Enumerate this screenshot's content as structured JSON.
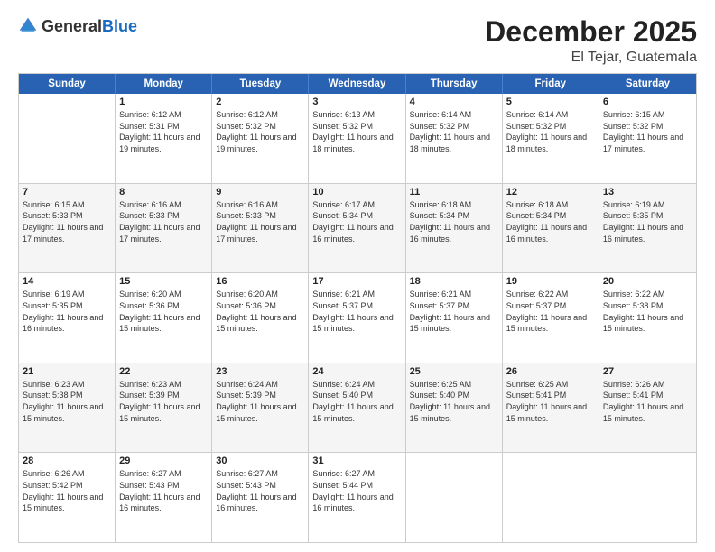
{
  "header": {
    "logo_general": "General",
    "logo_blue": "Blue",
    "month": "December 2025",
    "location": "El Tejar, Guatemala"
  },
  "days_of_week": [
    "Sunday",
    "Monday",
    "Tuesday",
    "Wednesday",
    "Thursday",
    "Friday",
    "Saturday"
  ],
  "weeks": [
    [
      {
        "day": "",
        "sunrise": "",
        "sunset": "",
        "daylight": ""
      },
      {
        "day": "1",
        "sunrise": "6:12 AM",
        "sunset": "5:31 PM",
        "daylight": "11 hours and 19 minutes."
      },
      {
        "day": "2",
        "sunrise": "6:12 AM",
        "sunset": "5:32 PM",
        "daylight": "11 hours and 19 minutes."
      },
      {
        "day": "3",
        "sunrise": "6:13 AM",
        "sunset": "5:32 PM",
        "daylight": "11 hours and 18 minutes."
      },
      {
        "day": "4",
        "sunrise": "6:14 AM",
        "sunset": "5:32 PM",
        "daylight": "11 hours and 18 minutes."
      },
      {
        "day": "5",
        "sunrise": "6:14 AM",
        "sunset": "5:32 PM",
        "daylight": "11 hours and 18 minutes."
      },
      {
        "day": "6",
        "sunrise": "6:15 AM",
        "sunset": "5:32 PM",
        "daylight": "11 hours and 17 minutes."
      }
    ],
    [
      {
        "day": "7",
        "sunrise": "6:15 AM",
        "sunset": "5:33 PM",
        "daylight": "11 hours and 17 minutes."
      },
      {
        "day": "8",
        "sunrise": "6:16 AM",
        "sunset": "5:33 PM",
        "daylight": "11 hours and 17 minutes."
      },
      {
        "day": "9",
        "sunrise": "6:16 AM",
        "sunset": "5:33 PM",
        "daylight": "11 hours and 17 minutes."
      },
      {
        "day": "10",
        "sunrise": "6:17 AM",
        "sunset": "5:34 PM",
        "daylight": "11 hours and 16 minutes."
      },
      {
        "day": "11",
        "sunrise": "6:18 AM",
        "sunset": "5:34 PM",
        "daylight": "11 hours and 16 minutes."
      },
      {
        "day": "12",
        "sunrise": "6:18 AM",
        "sunset": "5:34 PM",
        "daylight": "11 hours and 16 minutes."
      },
      {
        "day": "13",
        "sunrise": "6:19 AM",
        "sunset": "5:35 PM",
        "daylight": "11 hours and 16 minutes."
      }
    ],
    [
      {
        "day": "14",
        "sunrise": "6:19 AM",
        "sunset": "5:35 PM",
        "daylight": "11 hours and 16 minutes."
      },
      {
        "day": "15",
        "sunrise": "6:20 AM",
        "sunset": "5:36 PM",
        "daylight": "11 hours and 15 minutes."
      },
      {
        "day": "16",
        "sunrise": "6:20 AM",
        "sunset": "5:36 PM",
        "daylight": "11 hours and 15 minutes."
      },
      {
        "day": "17",
        "sunrise": "6:21 AM",
        "sunset": "5:37 PM",
        "daylight": "11 hours and 15 minutes."
      },
      {
        "day": "18",
        "sunrise": "6:21 AM",
        "sunset": "5:37 PM",
        "daylight": "11 hours and 15 minutes."
      },
      {
        "day": "19",
        "sunrise": "6:22 AM",
        "sunset": "5:37 PM",
        "daylight": "11 hours and 15 minutes."
      },
      {
        "day": "20",
        "sunrise": "6:22 AM",
        "sunset": "5:38 PM",
        "daylight": "11 hours and 15 minutes."
      }
    ],
    [
      {
        "day": "21",
        "sunrise": "6:23 AM",
        "sunset": "5:38 PM",
        "daylight": "11 hours and 15 minutes."
      },
      {
        "day": "22",
        "sunrise": "6:23 AM",
        "sunset": "5:39 PM",
        "daylight": "11 hours and 15 minutes."
      },
      {
        "day": "23",
        "sunrise": "6:24 AM",
        "sunset": "5:39 PM",
        "daylight": "11 hours and 15 minutes."
      },
      {
        "day": "24",
        "sunrise": "6:24 AM",
        "sunset": "5:40 PM",
        "daylight": "11 hours and 15 minutes."
      },
      {
        "day": "25",
        "sunrise": "6:25 AM",
        "sunset": "5:40 PM",
        "daylight": "11 hours and 15 minutes."
      },
      {
        "day": "26",
        "sunrise": "6:25 AM",
        "sunset": "5:41 PM",
        "daylight": "11 hours and 15 minutes."
      },
      {
        "day": "27",
        "sunrise": "6:26 AM",
        "sunset": "5:41 PM",
        "daylight": "11 hours and 15 minutes."
      }
    ],
    [
      {
        "day": "28",
        "sunrise": "6:26 AM",
        "sunset": "5:42 PM",
        "daylight": "11 hours and 15 minutes."
      },
      {
        "day": "29",
        "sunrise": "6:27 AM",
        "sunset": "5:43 PM",
        "daylight": "11 hours and 16 minutes."
      },
      {
        "day": "30",
        "sunrise": "6:27 AM",
        "sunset": "5:43 PM",
        "daylight": "11 hours and 16 minutes."
      },
      {
        "day": "31",
        "sunrise": "6:27 AM",
        "sunset": "5:44 PM",
        "daylight": "11 hours and 16 minutes."
      },
      {
        "day": "",
        "sunrise": "",
        "sunset": "",
        "daylight": ""
      },
      {
        "day": "",
        "sunrise": "",
        "sunset": "",
        "daylight": ""
      },
      {
        "day": "",
        "sunrise": "",
        "sunset": "",
        "daylight": ""
      }
    ]
  ],
  "labels": {
    "sunrise_prefix": "Sunrise: ",
    "sunset_prefix": "Sunset: ",
    "daylight_prefix": "Daylight: "
  }
}
